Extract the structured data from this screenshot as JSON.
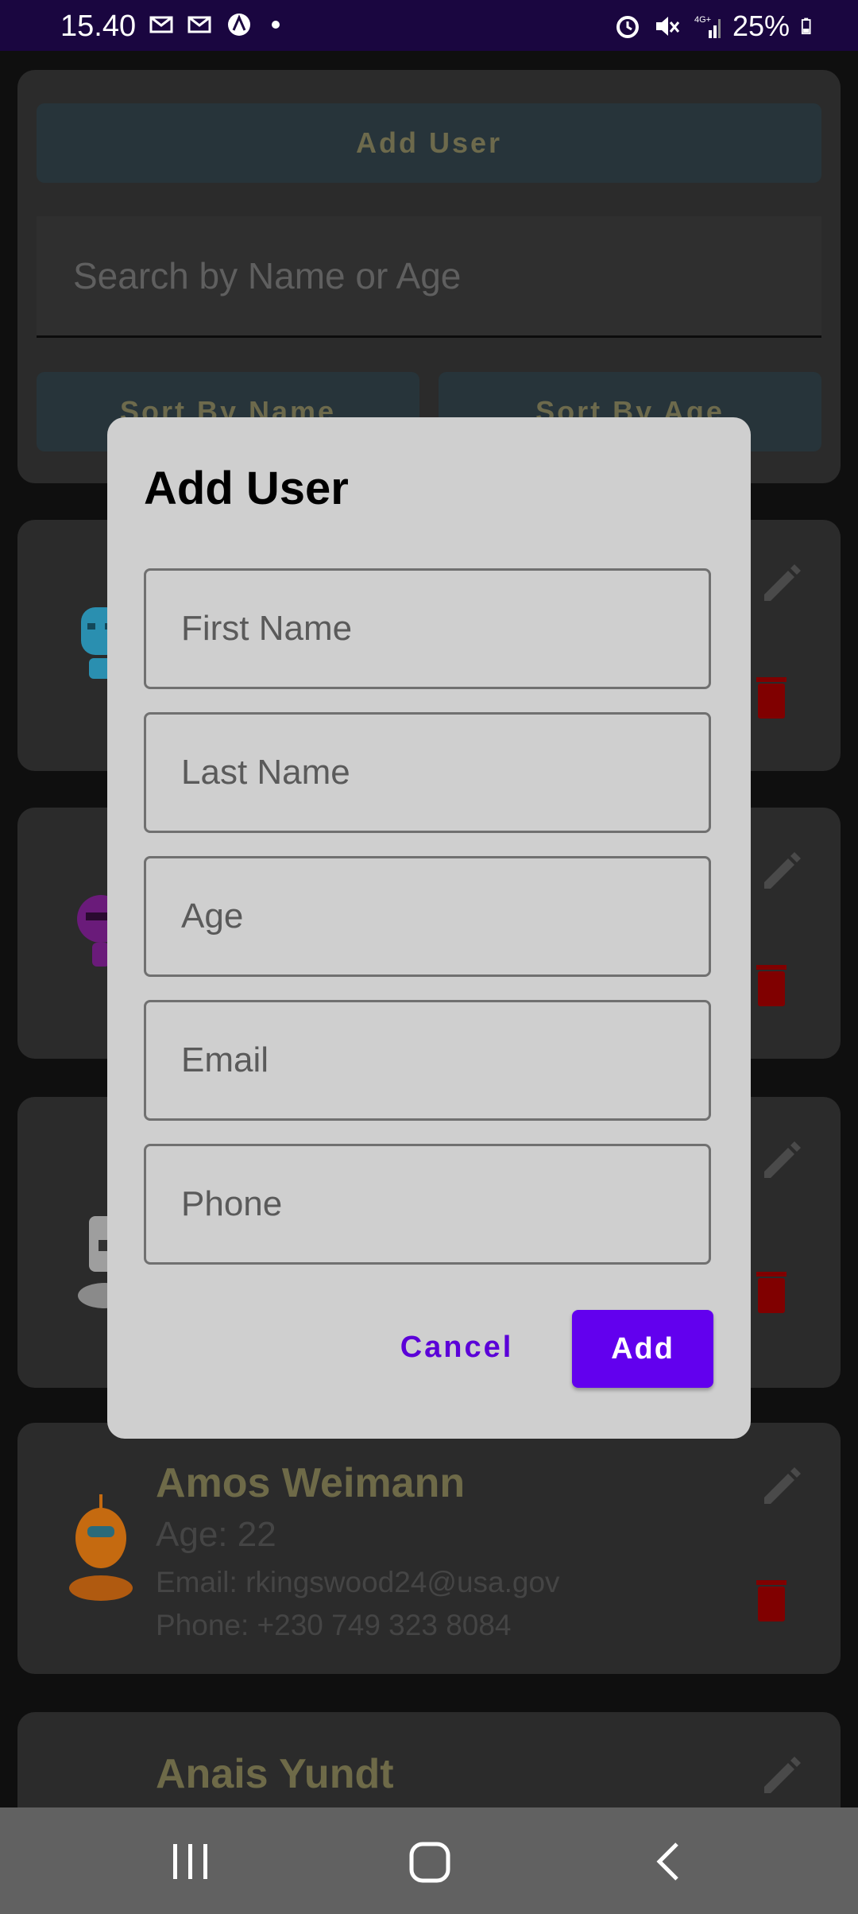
{
  "status_bar": {
    "time": "15.40",
    "battery": "25%"
  },
  "background": {
    "add_user_label": "Add User",
    "search_placeholder": "Search by Name or Age",
    "sort_by_name_label": "Sort By Name",
    "sort_by_age_label": "Sort By Age",
    "users": [
      {
        "name": "",
        "age": "",
        "email": "",
        "phone": ""
      },
      {
        "name": "",
        "age": "",
        "email": "",
        "phone": ""
      },
      {
        "name": "",
        "age": "",
        "email": "",
        "phone": ""
      },
      {
        "name": "Amos Weimann",
        "age": "Age: 22",
        "email": "Email: rkingswood24@usa.gov",
        "phone": "Phone: +230 749 323 8084"
      },
      {
        "name": "Anais Yundt",
        "age": "",
        "email": "",
        "phone": ""
      }
    ]
  },
  "dialog": {
    "title": "Add User",
    "fields": {
      "first_name": {
        "placeholder": "First Name",
        "value": ""
      },
      "last_name": {
        "placeholder": "Last Name",
        "value": ""
      },
      "age": {
        "placeholder": "Age",
        "value": ""
      },
      "email": {
        "placeholder": "Email",
        "value": ""
      },
      "phone": {
        "placeholder": "Phone",
        "value": ""
      }
    },
    "cancel_label": "Cancel",
    "add_label": "Add"
  },
  "colors": {
    "accent": "#6200ee",
    "dialog_bg": "#cfcfcf",
    "status_bar": "#1a0640"
  },
  "icons": [
    "alarm-icon",
    "mute-icon",
    "signal-icon",
    "battery-icon",
    "edit-icon",
    "delete-icon",
    "recents-icon",
    "home-icon",
    "back-icon"
  ]
}
